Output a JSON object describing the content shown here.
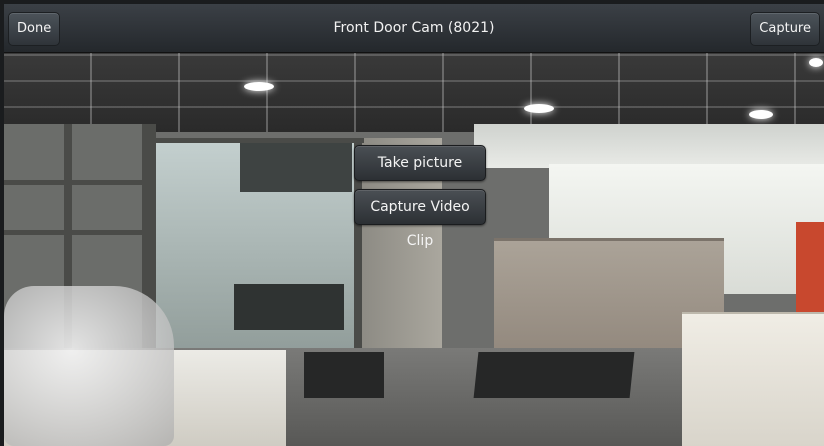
{
  "topbar": {
    "done_label": "Done",
    "title": "Front Door Cam (8021)",
    "capture_label": "Capture"
  },
  "overlay": {
    "take_picture_label": "Take picture",
    "capture_video_label": "Capture Video Clip"
  },
  "colors": {
    "bar_top": "#3b4046",
    "bar_bottom": "#24282c",
    "button_text": "#f4f4f4"
  }
}
